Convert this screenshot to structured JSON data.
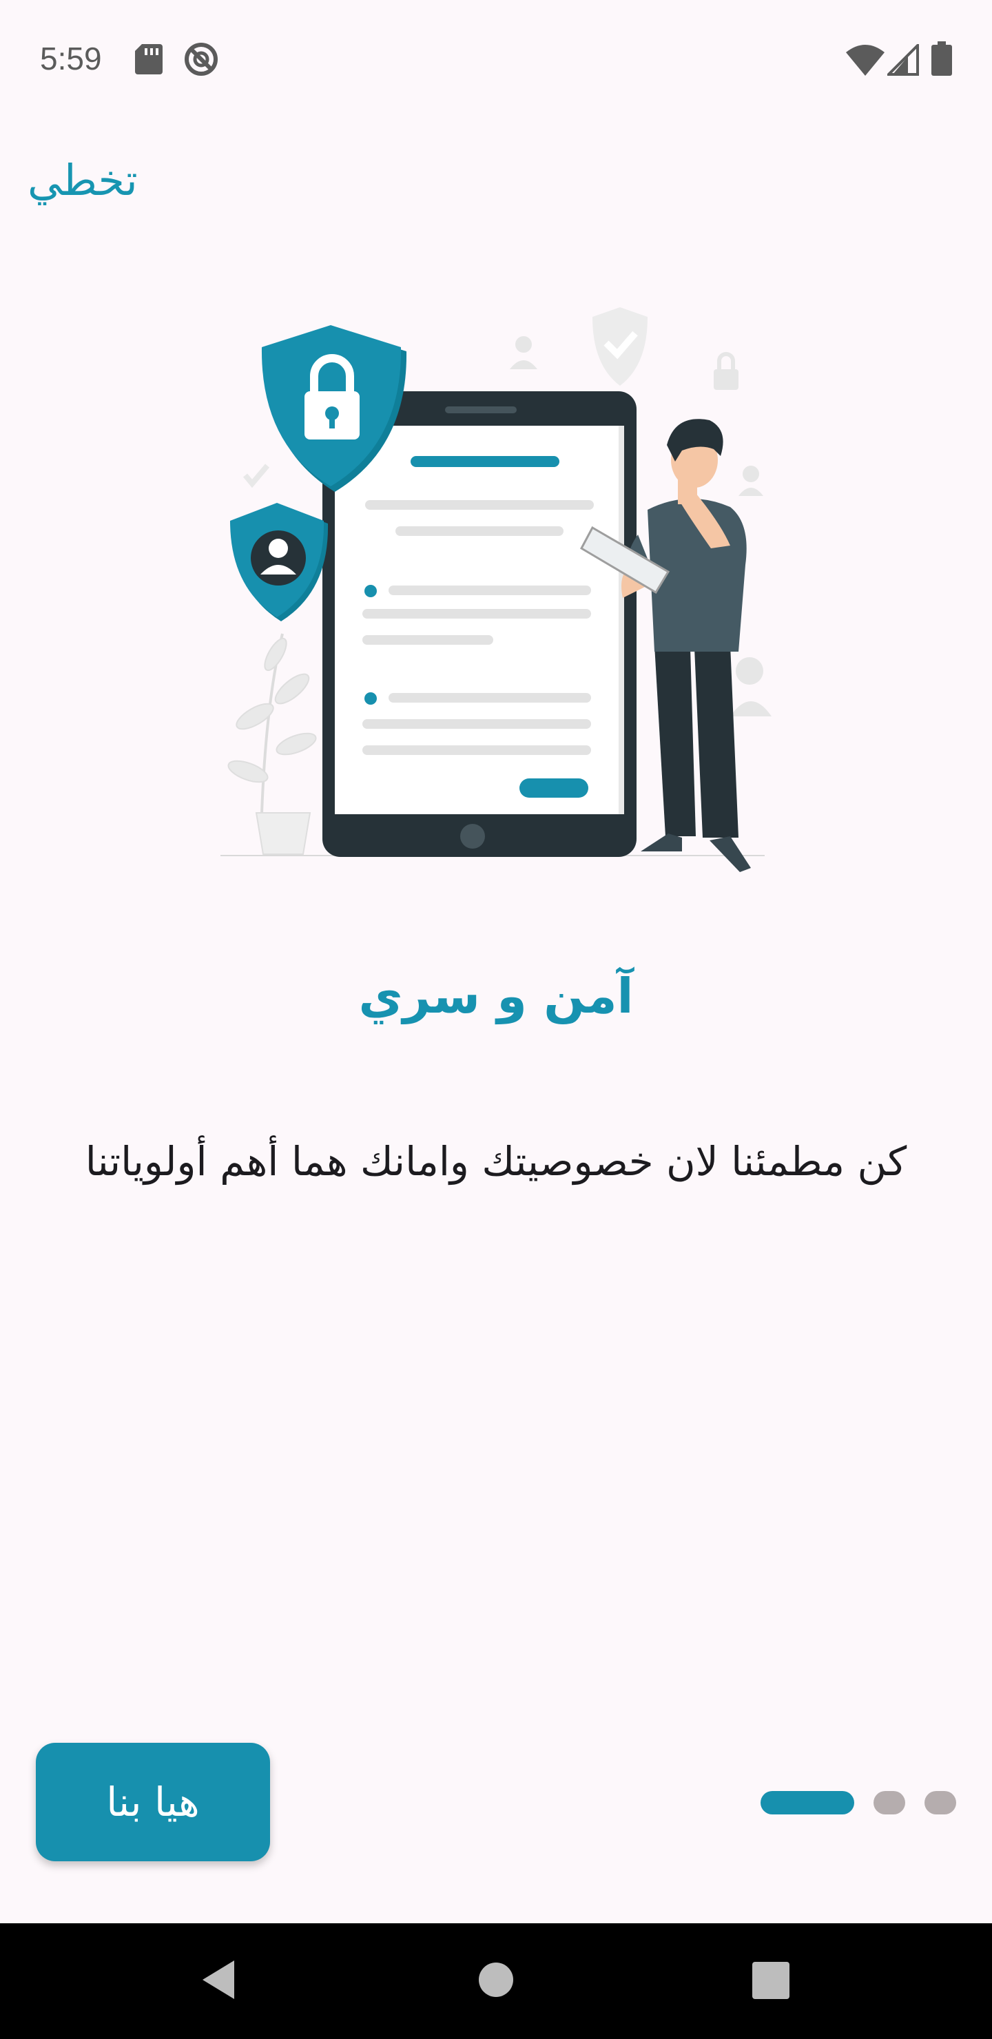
{
  "status_bar": {
    "time": "5:59",
    "icons": [
      "sd-card-icon",
      "do-not-disturb-icon",
      "wifi-icon",
      "signal-icon",
      "battery-icon"
    ]
  },
  "header": {
    "skip_label": "تخطي"
  },
  "main": {
    "title": "آمن و سري",
    "description": "كن مطمئنا لان خصوصيتك وامانك هما أهم أولوياتنا"
  },
  "footer": {
    "start_label": "هيا بنا",
    "pager": {
      "page_count": 3,
      "current_page": 1
    }
  },
  "nav_bar": {
    "icons": [
      "back-icon",
      "home-icon",
      "recents-icon"
    ]
  },
  "colors": {
    "accent": "#1790ae",
    "background": "#fdf8fb",
    "text": "#1c1b1f",
    "inactive_dot": "#b5adae"
  }
}
